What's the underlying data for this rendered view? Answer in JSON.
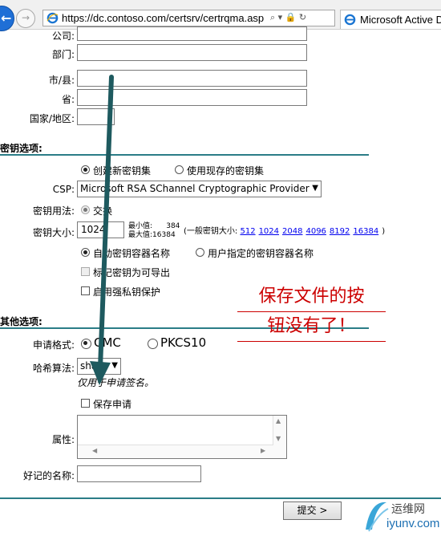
{
  "browser": {
    "url": "https://dc.contoso.com/certsrv/certrqma.asp",
    "tab_title": "Microsoft Active D",
    "fwd_glyph": "→"
  },
  "identity": {
    "company_label": "公司:",
    "department_label": "部门:",
    "city_label": "市/县:",
    "state_label": "省:",
    "country_label": "国家/地区:"
  },
  "key_options": {
    "header": "密钥选项:",
    "create_new": "创建新密钥集",
    "use_existing": "使用现存的密钥集",
    "csp_label": "CSP:",
    "csp_value": "Microsoft RSA SChannel Cryptographic Provider",
    "usage_label": "密钥用法:",
    "usage_exchange": "交换",
    "size_label": "密钥大小:",
    "size_value": "1024",
    "min_text": "最小值:",
    "min_value": "384",
    "max_text": "最大值:",
    "max_value": "16384",
    "common_sizes_prefix": "(一般密钥大小:",
    "common_sizes": [
      "512",
      "1024",
      "2048",
      "4096",
      "8192",
      "16384"
    ],
    "common_sizes_suffix": ")",
    "auto_container": "自动密钥容器名称",
    "user_container": "用户指定的密钥容器名称",
    "exportable": "标记密钥为可导出",
    "strong_protect": "启用强私钥保护"
  },
  "other_options": {
    "header": "其他选项:",
    "format_label": "申请格式:",
    "format_cmc": "CMC",
    "format_pkcs10": "PKCS10",
    "hash_label": "哈希算法:",
    "hash_value": "sha1",
    "hash_note": "仅用于申请签名。",
    "save_request": "保存申请",
    "attributes_label": "属性:",
    "friendly_label": "好记的名称:"
  },
  "submit_label": "提交 >",
  "annotation": {
    "line1": "保存文件的按",
    "line2": "钮没有了！"
  },
  "watermark": {
    "cn": "运维网",
    "en": "iyunv.com"
  },
  "colors": {
    "accent": "#2b7d87",
    "annotation": "#cc0000",
    "arrow": "#1e5a5f",
    "link": "#0000ee"
  }
}
